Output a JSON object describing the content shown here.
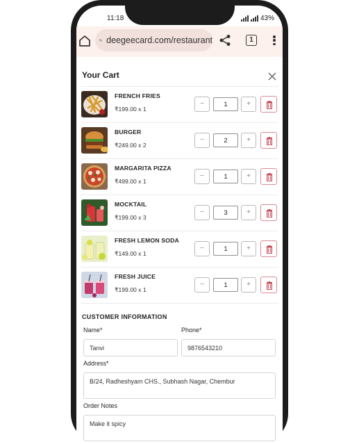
{
  "status_bar": {
    "time": "11:18",
    "battery": "43%"
  },
  "browser": {
    "url": "deegeecard.com/restaurant",
    "tab_count": "1"
  },
  "cart": {
    "title": "Your Cart",
    "items": [
      {
        "name": "FRENCH FRIES",
        "price": "₹199.00 x 1",
        "qty": "1"
      },
      {
        "name": "BURGER",
        "price": "₹249.00 x 2",
        "qty": "2"
      },
      {
        "name": "MARGARITA PIZZA",
        "price": "₹499.00 x 1",
        "qty": "1"
      },
      {
        "name": "MOCKTAIL",
        "price": "₹199.00 x 3",
        "qty": "3"
      },
      {
        "name": "FRESH LEMON SODA",
        "price": "₹149.00 x 1",
        "qty": "1"
      },
      {
        "name": "FRESH JUICE",
        "price": "₹199.00 x 1",
        "qty": "1"
      }
    ],
    "minus": "−",
    "plus": "+"
  },
  "customer": {
    "section_title": "CUSTOMER INFORMATION",
    "name_label": "Name*",
    "name_value": "Tanvi",
    "phone_label": "Phone*",
    "phone_value": "9876543210",
    "address_label": "Address*",
    "address_value": "B/24, Radheshyam CHS., Subhash Nagar, Chembur",
    "notes_label": "Order Notes",
    "notes_value": "Make it spicy"
  },
  "colors": {
    "accent_delete": "#c94a5a",
    "browser_bar": "#fdf1ee"
  },
  "icons": [
    "home-icon",
    "site-settings-icon",
    "share-icon",
    "tabs-icon",
    "menu-icon",
    "close-icon",
    "trash-icon"
  ]
}
